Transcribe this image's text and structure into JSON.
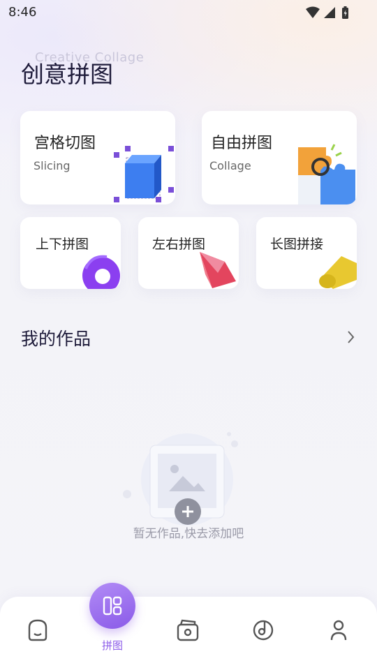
{
  "status_bar": {
    "time": "8:46"
  },
  "header": {
    "subtitle": "Creative Collage",
    "title": "创意拼图"
  },
  "tools_main": [
    {
      "title": "宫格切图",
      "subtitle": "Slicing",
      "icon": "cube-icon"
    },
    {
      "title": "自由拼图",
      "subtitle": "Collage",
      "icon": "puzzle-icon"
    }
  ],
  "tools_small": [
    {
      "title": "上下拼图",
      "icon": "torus-icon"
    },
    {
      "title": "左右拼图",
      "icon": "gem-icon"
    },
    {
      "title": "长图拼接",
      "icon": "cylinder-icon"
    }
  ],
  "works": {
    "title": "我的作品",
    "empty_text": "暂无作品,快去添加吧"
  },
  "tabbar": {
    "tabs": [
      {
        "name": "home",
        "icon": "face-home-icon",
        "label": ""
      },
      {
        "name": "collage",
        "icon": "grid-layout-icon",
        "label": "拼图",
        "active": true
      },
      {
        "name": "album",
        "icon": "wallet-photo-icon",
        "label": ""
      },
      {
        "name": "music",
        "icon": "music-disc-icon",
        "label": ""
      },
      {
        "name": "profile",
        "icon": "person-icon",
        "label": ""
      }
    ]
  },
  "colors": {
    "accent": "#8d5de9",
    "title": "#1e1b3a",
    "background": "#f4f3f9"
  }
}
